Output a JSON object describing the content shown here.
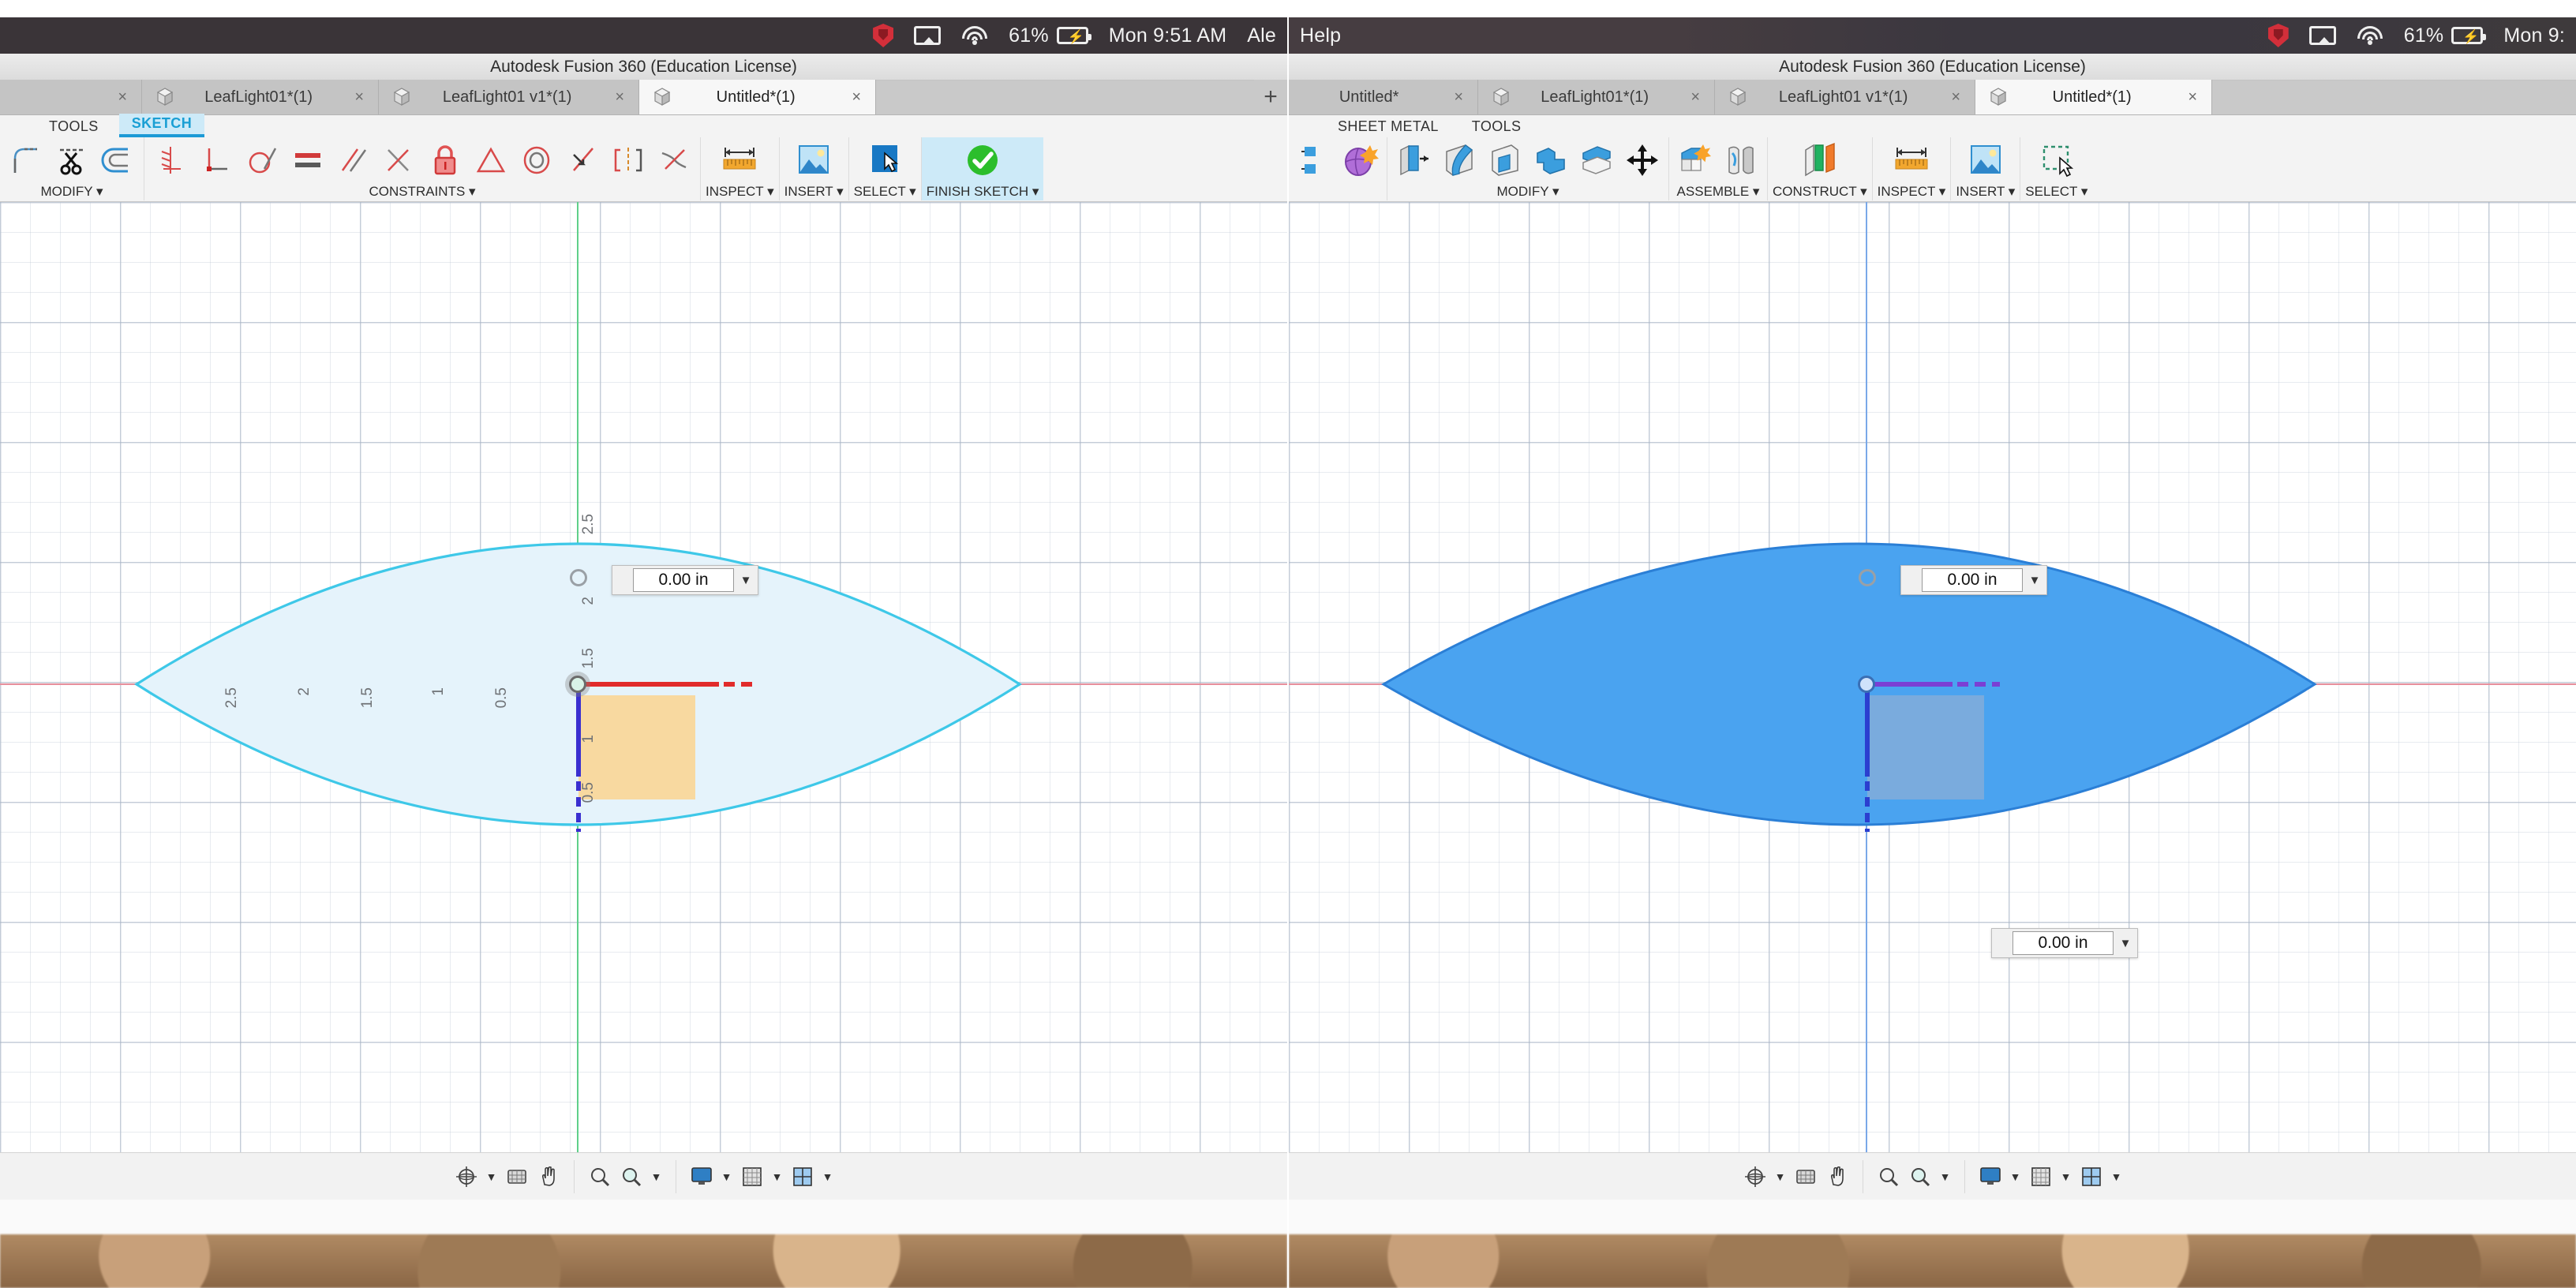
{
  "app": {
    "title": "Autodesk Fusion 360 (Education License)"
  },
  "macbar": {
    "left_menu_right": "Help",
    "items": [
      {
        "name": "mcafee-icon",
        "label": ""
      },
      {
        "name": "airplay-icon",
        "label": ""
      },
      {
        "name": "wifi-icon",
        "label": ""
      },
      {
        "name": "battery-percent",
        "label": "61%"
      },
      {
        "name": "clock",
        "label": "Mon 9:51 AM"
      },
      {
        "name": "user-account",
        "label": "Ale"
      }
    ],
    "battery_percent": "61%",
    "clock_left": "Mon 9:51 AM",
    "clock_right": "Mon 9:",
    "user": "Ale"
  },
  "left": {
    "tabs": [
      {
        "label": "",
        "active": false,
        "close": "×",
        "icon": ""
      },
      {
        "label": "LeafLight01*(1)",
        "active": false,
        "close": "×",
        "icon": "cube-icon"
      },
      {
        "label": "LeafLight01 v1*(1)",
        "active": false,
        "close": "×",
        "icon": "cube-icon"
      },
      {
        "label": "Untitled*(1)",
        "active": true,
        "close": "×",
        "icon": "cube-icon"
      }
    ],
    "new_tab": "+",
    "ribbon_tabs": [
      {
        "label": "TOOLS",
        "active": false
      },
      {
        "label": "SKETCH",
        "active": true
      }
    ],
    "groups": [
      {
        "label": "MODIFY ▾",
        "icons": [
          "fillet-icon",
          "trim-icon",
          "offset-icon"
        ]
      },
      {
        "label": "CONSTRAINTS ▾",
        "icons": [
          "coincident-icon",
          "perpendicular-icon",
          "tangent-icon",
          "equal-icon",
          "parallel-icon",
          "midpoint-icon",
          "fix-icon",
          "symmetry-icon",
          "concentric-icon",
          "collinear-icon",
          "vertical-icon",
          "horizontal-icon"
        ]
      },
      {
        "label": "INSPECT ▾",
        "icons": [
          "measure-icon"
        ]
      },
      {
        "label": "INSERT ▾",
        "icons": [
          "insert-image-icon"
        ]
      },
      {
        "label": "SELECT ▾",
        "icons": [
          "select-cursor-icon"
        ]
      },
      {
        "label": "FINISH SKETCH ▾",
        "icons": [
          "finish-sketch-check-icon"
        ]
      }
    ],
    "canvas": {
      "dimension_value": "0.00 in",
      "dimension_placeholder": "0.00 in",
      "v_ticks": [
        "2.5",
        "2",
        "1.5",
        "1",
        "0.5"
      ],
      "h_ticks": [
        "2.5",
        "2",
        "1.5",
        "1",
        "0.5"
      ],
      "shape": "leaf-lens-profile",
      "rect": "extrude-profile-rectangle"
    },
    "nav": {
      "groups": [
        [
          "orbit-icon",
          "caret",
          "display-settings-icon",
          "pan-icon"
        ],
        [
          "zoom-icon",
          "zoom-window-icon",
          "caret"
        ],
        [
          "display-mode-icon",
          "caret",
          "grid-snap-icon",
          "caret",
          "viewports-icon",
          "caret"
        ]
      ]
    }
  },
  "right": {
    "tabs": [
      {
        "label": "Untitled*",
        "active": false,
        "close": "×",
        "icon": ""
      },
      {
        "label": "LeafLight01*(1)",
        "active": false,
        "close": "×",
        "icon": "cube-icon"
      },
      {
        "label": "LeafLight01 v1*(1)",
        "active": false,
        "close": "×",
        "icon": "cube-icon"
      },
      {
        "label": "Untitled*(1)",
        "active": true,
        "close": "×",
        "icon": "cube-icon"
      }
    ],
    "ribbon_tabs": [
      {
        "label": "SHEET METAL",
        "active": false
      },
      {
        "label": "TOOLS",
        "active": false
      }
    ],
    "groups": [
      {
        "label": "",
        "icons": [
          "sketch-icon",
          "create-form-icon"
        ]
      },
      {
        "label": "MODIFY ▾",
        "icons": [
          "press-pull-icon",
          "fillet-icon",
          "shell-icon",
          "combine-icon",
          "split-face-icon",
          "move-copy-icon"
        ]
      },
      {
        "label": "ASSEMBLE ▾",
        "icons": [
          "new-component-icon",
          "joint-icon"
        ]
      },
      {
        "label": "CONSTRUCT ▾",
        "icons": [
          "offset-plane-icon"
        ]
      },
      {
        "label": "INSPECT ▾",
        "icons": [
          "measure-icon"
        ]
      },
      {
        "label": "INSERT ▾",
        "icons": [
          "insert-image-icon"
        ]
      },
      {
        "label": "SELECT ▾",
        "icons": [
          "select-window-icon"
        ]
      }
    ],
    "canvas": {
      "dimension_value_top": "0.00 in",
      "dimension_value_mid": "0.00 in",
      "dimension_placeholder": "0.00 in",
      "shape": "leaf-lens-profile-selected",
      "rect": "extrude-profile-rectangle-selected"
    },
    "nav": {
      "groups": [
        [
          "orbit-icon",
          "caret",
          "display-settings-icon",
          "pan-icon"
        ],
        [
          "zoom-icon",
          "zoom-window-icon",
          "caret"
        ],
        [
          "display-mode-icon",
          "caret",
          "grid-snap-icon",
          "caret",
          "viewports-icon",
          "caret"
        ]
      ]
    }
  },
  "colors": {
    "accent_blue": "#1c9ad6",
    "sketch_fill": "#e8f4fb",
    "sketch_stroke": "#3ec8e8",
    "selected_blue": "#4aa3f0",
    "profile_orange": "#f8d9a0",
    "axis_red": "#e8909c",
    "axis_green": "#5fd08a",
    "constraint_red": "#e03030",
    "constraint_blue": "#3a2fd0"
  }
}
